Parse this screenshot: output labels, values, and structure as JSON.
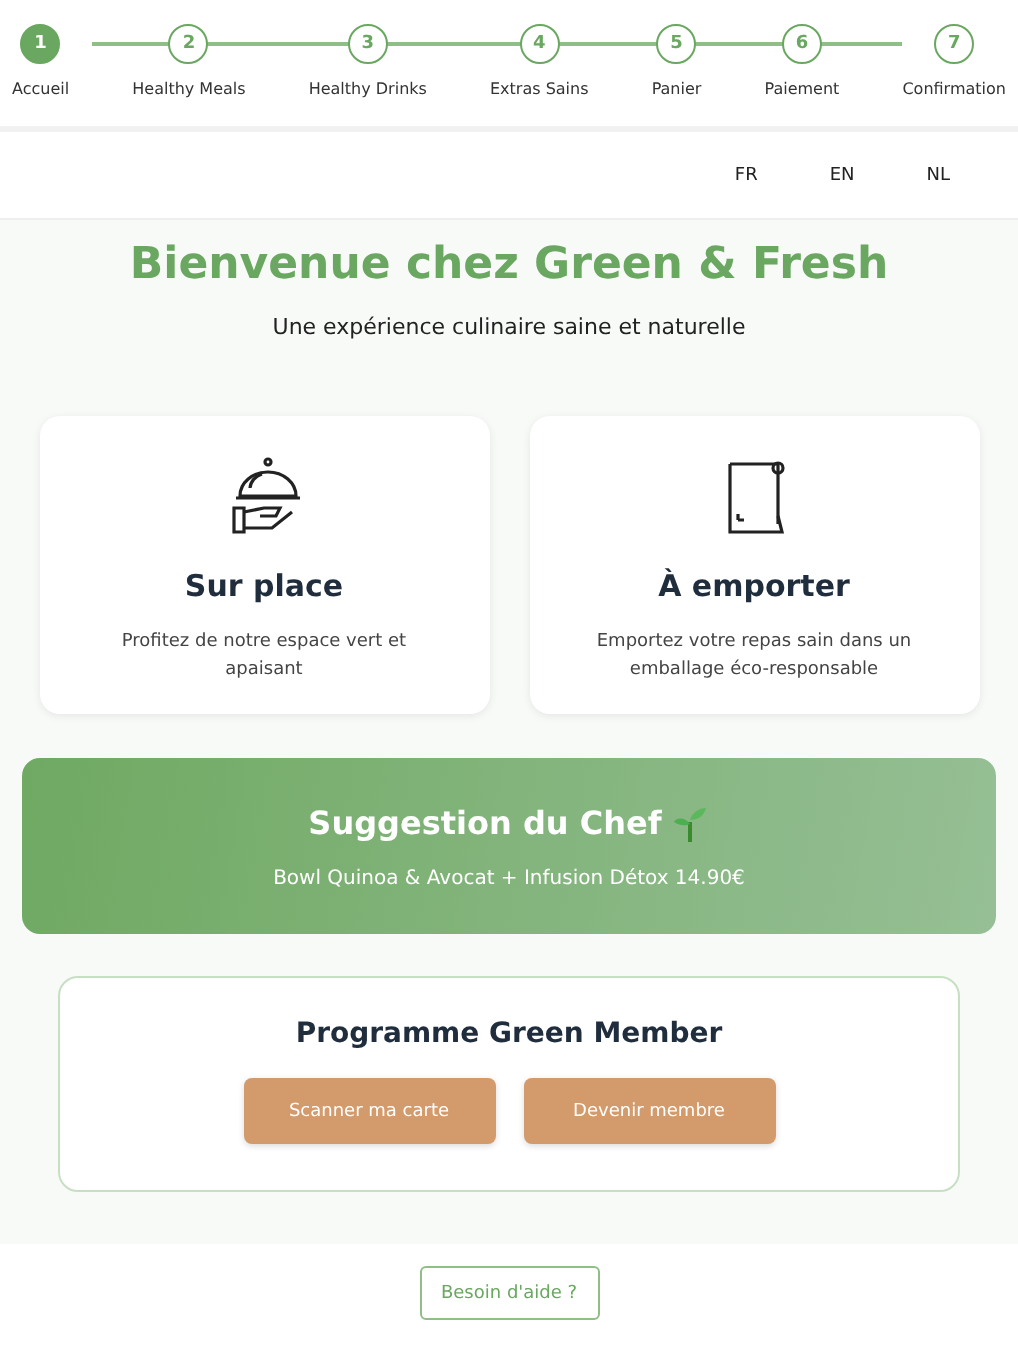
{
  "steps": [
    {
      "number": "1",
      "label": "Accueil",
      "selected": true
    },
    {
      "number": "2",
      "label": "Healthy Meals",
      "selected": false
    },
    {
      "number": "3",
      "label": "Healthy Drinks",
      "selected": false
    },
    {
      "number": "4",
      "label": "Extras Sains",
      "selected": false
    },
    {
      "number": "5",
      "label": "Panier",
      "selected": false
    },
    {
      "number": "6",
      "label": "Paiement",
      "selected": false
    },
    {
      "number": "7",
      "label": "Confirmation",
      "selected": false
    }
  ],
  "languages": [
    "FR",
    "EN",
    "NL"
  ],
  "title": "Bienvenue chez Green & Fresh",
  "subtitle": "Une expérience culinaire saine et naturelle",
  "options": [
    {
      "kind": "dine-in",
      "title": "Sur place",
      "text": "Profitez de notre espace vert et apaisant"
    },
    {
      "kind": "takeaway",
      "title": "À emporter",
      "text": "Emportez votre repas sain dans un emballage éco-responsable"
    }
  ],
  "chef_suggestion": {
    "title": "Suggestion du Chef",
    "text": "Bowl Quinoa & Avocat + Infusion Détox 14.90€"
  },
  "member": {
    "title": "Programme Green Member",
    "buttons": [
      "Scanner ma carte",
      "Devenir membre"
    ]
  },
  "help_button": "Besoin d'aide ?"
}
